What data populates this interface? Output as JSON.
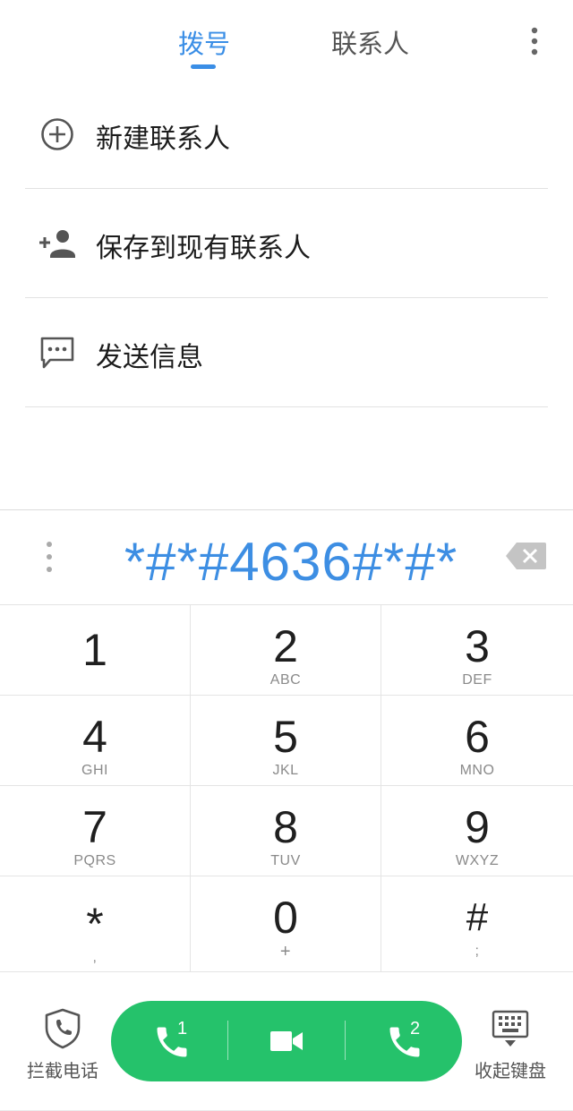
{
  "header": {
    "tabs": [
      {
        "label": "拨号",
        "active": true
      },
      {
        "label": "联系人",
        "active": false
      }
    ],
    "more_icon": "more-vertical-icon",
    "accent_color": "#3a8ee6"
  },
  "actions": [
    {
      "label": "新建联系人",
      "icon": "add-circle-icon"
    },
    {
      "label": "保存到现有联系人",
      "icon": "add-person-icon"
    },
    {
      "label": "发送信息",
      "icon": "message-icon"
    }
  ],
  "dialer": {
    "number": "*#*#4636#*#*",
    "number_color": "#3d8ee3",
    "keys": [
      {
        "digit": "1",
        "letters": ""
      },
      {
        "digit": "2",
        "letters": "ABC"
      },
      {
        "digit": "3",
        "letters": "DEF"
      },
      {
        "digit": "4",
        "letters": "GHI"
      },
      {
        "digit": "5",
        "letters": "JKL"
      },
      {
        "digit": "6",
        "letters": "MNO"
      },
      {
        "digit": "7",
        "letters": "PQRS"
      },
      {
        "digit": "8",
        "letters": "TUV"
      },
      {
        "digit": "9",
        "letters": "WXYZ"
      },
      {
        "digit": "*",
        "letters": ","
      },
      {
        "digit": "0",
        "letters": "+"
      },
      {
        "digit": "#",
        "letters": ";"
      }
    ]
  },
  "bottom_bar": {
    "block_calls_label": "拦截电话",
    "hide_keypad_label": "收起键盘",
    "call_color": "#25c26b",
    "sim1_label": "1",
    "sim2_label": "2"
  }
}
